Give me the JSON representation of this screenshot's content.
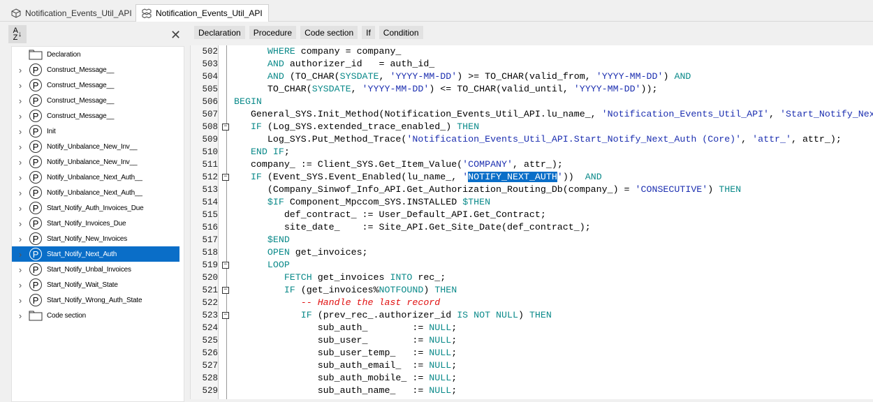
{
  "tabs": [
    {
      "label": "Notification_Events_Util_API",
      "icon": "package-icon"
    },
    {
      "label": "Notification_Events_Util_API",
      "icon": "package-body-icon",
      "active": true
    }
  ],
  "sidebar": {
    "sort_label": "A Z",
    "items": [
      {
        "label": "Declaration",
        "type": "folder"
      },
      {
        "label": "Construct_Message__",
        "type": "procedure"
      },
      {
        "label": "Construct_Message__",
        "type": "procedure"
      },
      {
        "label": "Construct_Message__",
        "type": "procedure"
      },
      {
        "label": "Construct_Message__",
        "type": "procedure"
      },
      {
        "label": "Init",
        "type": "procedure"
      },
      {
        "label": "Notify_Unbalance_New_Inv__",
        "type": "procedure"
      },
      {
        "label": "Notify_Unbalance_New_Inv__",
        "type": "procedure"
      },
      {
        "label": "Notify_Unbalance_Next_Auth__",
        "type": "procedure"
      },
      {
        "label": "Notify_Unbalance_Next_Auth__",
        "type": "procedure"
      },
      {
        "label": "Start_Notify_Auth_Invoices_Due",
        "type": "procedure"
      },
      {
        "label": "Start_Notify_Invoices_Due",
        "type": "procedure"
      },
      {
        "label": "Start_Notify_New_Invoices",
        "type": "procedure"
      },
      {
        "label": "Start_Notify_Next_Auth",
        "type": "procedure",
        "selected": true
      },
      {
        "label": "Start_Notify_Unbal_Invoices",
        "type": "procedure"
      },
      {
        "label": "Start_Notify_Wait_State",
        "type": "procedure"
      },
      {
        "label": "Start_Notify_Wrong_Auth_State",
        "type": "procedure"
      },
      {
        "label": "Code section",
        "type": "folder"
      }
    ]
  },
  "toolbar": [
    "Declaration",
    "Procedure",
    "Code section",
    "If",
    "Condition"
  ],
  "code": [
    {
      "n": "502",
      "segs": [
        [
          "",
          "      "
        ],
        [
          "kw",
          "WHERE"
        ],
        [
          "",
          " company = company_"
        ]
      ]
    },
    {
      "n": "503",
      "segs": [
        [
          "",
          "      "
        ],
        [
          "kw",
          "AND"
        ],
        [
          "",
          " authorizer_id   = auth_id_"
        ]
      ]
    },
    {
      "n": "504",
      "segs": [
        [
          "",
          "      "
        ],
        [
          "kw",
          "AND"
        ],
        [
          "",
          " (TO_CHAR("
        ],
        [
          "kw",
          "SYSDATE"
        ],
        [
          "",
          ", "
        ],
        [
          "str",
          "'YYYY-MM-DD'"
        ],
        [
          "",
          ") >= TO_CHAR(valid_from, "
        ],
        [
          "str",
          "'YYYY-MM-DD'"
        ],
        [
          "",
          ") "
        ],
        [
          "kw",
          "AND"
        ]
      ]
    },
    {
      "n": "505",
      "segs": [
        [
          "",
          "      TO_CHAR("
        ],
        [
          "kw",
          "SYSDATE"
        ],
        [
          "",
          ", "
        ],
        [
          "str",
          "'YYYY-MM-DD'"
        ],
        [
          "",
          ") <= TO_CHAR(valid_until, "
        ],
        [
          "str",
          "'YYYY-MM-DD'"
        ],
        [
          "",
          "));"
        ]
      ]
    },
    {
      "n": "506",
      "segs": [
        [
          "kw",
          "BEGIN"
        ]
      ]
    },
    {
      "n": "507",
      "segs": [
        [
          "",
          "   General_SYS.Init_Method(Notification_Events_Util_API.lu_name_, "
        ],
        [
          "str",
          "'Notification_Events_Util_API'"
        ],
        [
          "",
          ", "
        ],
        [
          "str",
          "'Start_Notify_Nex"
        ]
      ]
    },
    {
      "n": "508",
      "fold": true,
      "segs": [
        [
          "",
          "   "
        ],
        [
          "kw",
          "IF"
        ],
        [
          "",
          " (Log_SYS.extended_trace_enabled_) "
        ],
        [
          "kw",
          "THEN"
        ]
      ]
    },
    {
      "n": "509",
      "segs": [
        [
          "",
          "      Log_SYS.Put_Method_Trace("
        ],
        [
          "str",
          "'Notification_Events_Util_API.Start_Notify_Next_Auth (Core)'"
        ],
        [
          "",
          ", "
        ],
        [
          "str",
          "'attr_'"
        ],
        [
          "",
          ", attr_);"
        ]
      ]
    },
    {
      "n": "510",
      "segs": [
        [
          "",
          "   "
        ],
        [
          "kw",
          "END IF"
        ],
        [
          "",
          ";"
        ]
      ]
    },
    {
      "n": "511",
      "segs": [
        [
          "",
          "   company_ := Client_SYS.Get_Item_Value("
        ],
        [
          "str",
          "'COMPANY'"
        ],
        [
          "",
          ", attr_);"
        ]
      ]
    },
    {
      "n": "512",
      "fold": true,
      "segs": [
        [
          "",
          "   "
        ],
        [
          "kw",
          "IF"
        ],
        [
          "",
          " (Event_SYS.Event_Enabled(lu_name_, "
        ],
        [
          "str",
          "'"
        ],
        [
          "sel",
          "NOTIFY_NEXT_AUTH"
        ],
        [
          "str",
          "'"
        ],
        [
          "",
          "))"
        ],
        [
          "",
          ""
        ],
        [
          "",
          "  "
        ],
        [
          "kw",
          "AND"
        ]
      ]
    },
    {
      "n": "513",
      "segs": [
        [
          "",
          "      (Company_Sinwof_Info_API.Get_Authorization_Routing_Db(company_) = "
        ],
        [
          "str",
          "'CONSECUTIVE'"
        ],
        [
          "",
          ") "
        ],
        [
          "kw",
          "THEN"
        ]
      ]
    },
    {
      "n": "514",
      "segs": [
        [
          "",
          "      "
        ],
        [
          "kw",
          "$IF"
        ],
        [
          "",
          " Component_Mpccom_SYS.INSTALLED "
        ],
        [
          "kw",
          "$THEN"
        ]
      ]
    },
    {
      "n": "515",
      "segs": [
        [
          "",
          "         def_contract_ := User_Default_API.Get_Contract;"
        ]
      ]
    },
    {
      "n": "516",
      "segs": [
        [
          "",
          "         site_date_    := Site_API.Get_Site_Date(def_contract_);"
        ]
      ]
    },
    {
      "n": "517",
      "segs": [
        [
          "",
          "      "
        ],
        [
          "kw",
          "$END"
        ]
      ]
    },
    {
      "n": "518",
      "segs": [
        [
          "",
          "      "
        ],
        [
          "kw",
          "OPEN"
        ],
        [
          "",
          " get_invoices;"
        ]
      ]
    },
    {
      "n": "519",
      "fold": true,
      "segs": [
        [
          "",
          "      "
        ],
        [
          "kw",
          "LOOP"
        ]
      ]
    },
    {
      "n": "520",
      "segs": [
        [
          "",
          "         "
        ],
        [
          "kw",
          "FETCH"
        ],
        [
          "",
          " get_invoices "
        ],
        [
          "kw",
          "INTO"
        ],
        [
          "",
          " rec_;"
        ]
      ]
    },
    {
      "n": "521",
      "fold": true,
      "segs": [
        [
          "",
          "         "
        ],
        [
          "kw",
          "IF"
        ],
        [
          "",
          " (get_invoices%"
        ],
        [
          "kw",
          "NOTFOUND"
        ],
        [
          "",
          ") "
        ],
        [
          "kw",
          "THEN"
        ]
      ]
    },
    {
      "n": "522",
      "segs": [
        [
          "",
          "            "
        ],
        [
          "cm",
          "-- Handle the last record"
        ]
      ]
    },
    {
      "n": "523",
      "fold": true,
      "segs": [
        [
          "",
          "            "
        ],
        [
          "kw",
          "IF"
        ],
        [
          "",
          " (prev_rec_.authorizer_id "
        ],
        [
          "kw",
          "IS NOT NULL"
        ],
        [
          "",
          ") "
        ],
        [
          "kw",
          "THEN"
        ]
      ]
    },
    {
      "n": "524",
      "segs": [
        [
          "",
          "               sub_auth_        := "
        ],
        [
          "kw",
          "NULL"
        ],
        [
          "",
          ";"
        ]
      ]
    },
    {
      "n": "525",
      "segs": [
        [
          "",
          "               sub_user_        := "
        ],
        [
          "kw",
          "NULL"
        ],
        [
          "",
          ";"
        ]
      ]
    },
    {
      "n": "526",
      "segs": [
        [
          "",
          "               sub_user_temp_   := "
        ],
        [
          "kw",
          "NULL"
        ],
        [
          "",
          ";"
        ]
      ]
    },
    {
      "n": "527",
      "segs": [
        [
          "",
          "               sub_auth_email_  := "
        ],
        [
          "kw",
          "NULL"
        ],
        [
          "",
          ";"
        ]
      ]
    },
    {
      "n": "528",
      "segs": [
        [
          "",
          "               sub_auth_mobile_ := "
        ],
        [
          "kw",
          "NULL"
        ],
        [
          "",
          ";"
        ]
      ]
    },
    {
      "n": "529",
      "segs": [
        [
          "",
          "               sub_auth_name_   := "
        ],
        [
          "kw",
          "NULL"
        ],
        [
          "",
          ";"
        ]
      ]
    }
  ]
}
